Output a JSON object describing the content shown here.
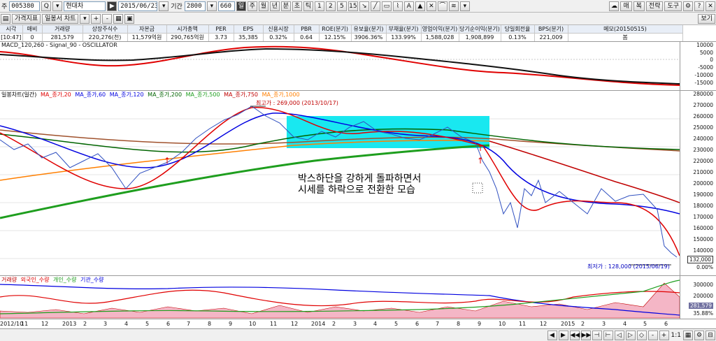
{
  "toolbar": {
    "prefix": "주",
    "code": "005380",
    "search_glyph": "Q",
    "stock_name": "현대차",
    "date": "2015/06/23",
    "period_label": "기간",
    "period_value": "2800",
    "count_value": "660",
    "periods": [
      "일",
      "주",
      "월",
      "년",
      "분",
      "초",
      "틱"
    ],
    "minutes": [
      "1",
      "2",
      "5",
      "15"
    ],
    "tool_glyphs": [
      "↘",
      "╱",
      "▭",
      "⌇",
      "A",
      "▲",
      "✕",
      "⌒",
      "≋",
      "▾"
    ],
    "right_buttons": [
      "매",
      "복",
      "전략",
      "도구"
    ],
    "view_label": "보기"
  },
  "toolbar2": {
    "tabs": [
      "가격지표",
      "일봉서 차트"
    ],
    "zoom_in": "+",
    "zoom_out": "-",
    "view_label": "보기"
  },
  "info": {
    "headers": [
      "시각",
      "매비",
      "거래량",
      "상장주식수",
      "자본금",
      "시가총액",
      "PER",
      "EPS",
      "신용시장",
      "PBR",
      "ROE(분기)",
      "유보율(분기)",
      "부채율(분기)",
      "영업이익(분기)",
      "당기순이익(분기)",
      "당일회전율",
      "BPS(분기)",
      "메모(20150515)"
    ],
    "values": [
      "[10:47]",
      "0",
      "281,579",
      "220,276(천)",
      "11,579억원",
      "290,765억원",
      "3.73",
      "35,385",
      "0.32%",
      "0.64",
      "12.15%",
      "3906.36%",
      "133.99%",
      "1,588,028",
      "1,908,899",
      "0.13%",
      "221,009",
      "봄"
    ]
  },
  "macd": {
    "legend": "MACD_120,260 - Signal_90 - OSCILLATOR",
    "y_labels": [
      "10000",
      "5000",
      "0",
      "-5000",
      "-10000",
      "-15000"
    ]
  },
  "price": {
    "legend": [
      "일봉차트(일간)",
      "MA_종가,20",
      "MA_종가,60",
      "MA_종가,120",
      "MA_종가,200",
      "MA_종가,500",
      "MA_종가,750",
      "MA_종가,1000"
    ],
    "legend_colors": [
      "#000000",
      "#e00000",
      "#0000e0",
      "#0000e0",
      "#006400",
      "#1e9e1e",
      "#c00000",
      "#ff7f00"
    ],
    "y_labels": [
      "280000",
      "270000",
      "260000",
      "250000",
      "240000",
      "230000",
      "220000",
      "210000",
      "200000",
      "190000",
      "180000",
      "170000",
      "160000",
      "150000",
      "140000"
    ],
    "last_price": "132,000",
    "last_pct": "0.00%",
    "high_note": "최고가 : 269,000 (2013/10/17)",
    "low_note": "최저가 : 128,000 (2015/06/19)",
    "annotation_line1": "박스하단을 강하게 돌파하면서",
    "annotation_line2": "시세를 하락으로 전환한 모습",
    "box_color": "#00e5ee",
    "arrow_color": "#e00000"
  },
  "volume": {
    "legend": [
      "거래량",
      "외국인_수량",
      "개인_수량",
      "기관_수량"
    ],
    "legend_colors": [
      "#c00000",
      "#e00000",
      "#1e9e1e",
      "#0000e0"
    ],
    "y_labels": [
      "300000",
      "200000",
      "100000"
    ],
    "last_volume": "281,579",
    "last_pct": "35.88%"
  },
  "x_axis": {
    "labels": [
      "2012/10",
      "11",
      "12",
      "2013",
      "2",
      "3",
      "4",
      "5",
      "6",
      "7",
      "8",
      "9",
      "10",
      "11",
      "12",
      "2014",
      "2",
      "3",
      "4",
      "5",
      "6",
      "7",
      "8",
      "9",
      "10",
      "11",
      "12",
      "2015",
      "2",
      "3",
      "4",
      "5",
      "6"
    ]
  },
  "bottom": {
    "nav": [
      "◀",
      "▶",
      "◀◀",
      "▶▶",
      "⊣",
      "⊢",
      "◁",
      "▷",
      "◇"
    ],
    "zoom": [
      "-",
      "+"
    ],
    "ratio": "1:1",
    "icons": [
      "▦",
      "⚙",
      "⊟"
    ]
  }
}
